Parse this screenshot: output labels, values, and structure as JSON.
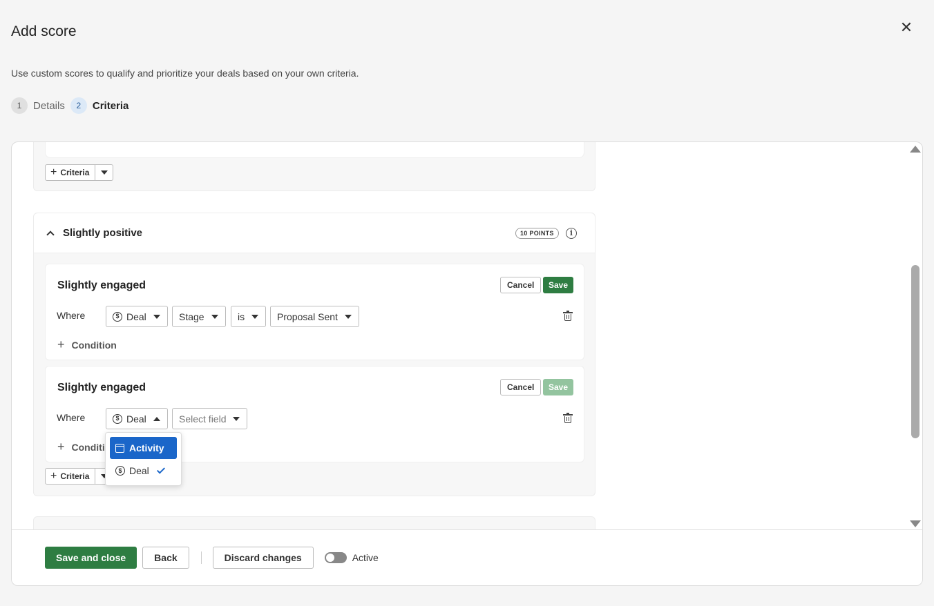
{
  "header": {
    "title": "Add score",
    "subtitle": "Use custom scores to qualify and prioritize your deals based on your own criteria."
  },
  "steps": [
    {
      "num": "1",
      "label": "Details"
    },
    {
      "num": "2",
      "label": "Criteria"
    }
  ],
  "criteria_button": "Criteria",
  "group": {
    "title": "Slightly positive",
    "points": "10 POINTS"
  },
  "rules": [
    {
      "title": "Slightly engaged",
      "cancel": "Cancel",
      "save": "Save",
      "where": "Where",
      "entity": "Deal",
      "field": "Stage",
      "operator": "is",
      "value": "Proposal Sent",
      "add_condition": "Condition"
    },
    {
      "title": "Slightly engaged",
      "cancel": "Cancel",
      "save": "Save",
      "where": "Where",
      "entity": "Deal",
      "field_placeholder": "Select field",
      "add_condition": "Conditi"
    }
  ],
  "dropdown": {
    "options": [
      {
        "label": "Activity",
        "icon": "calendar-icon",
        "highlighted": true
      },
      {
        "label": "Deal",
        "icon": "dollar-icon",
        "selected": true
      }
    ]
  },
  "footer": {
    "save_close": "Save and close",
    "back": "Back",
    "discard": "Discard changes",
    "toggle_label": "Active",
    "toggle_on": false
  },
  "colors": {
    "primary_green": "#2e7d42",
    "disabled_green": "#93c49f",
    "highlight_blue": "#1a66c9"
  }
}
